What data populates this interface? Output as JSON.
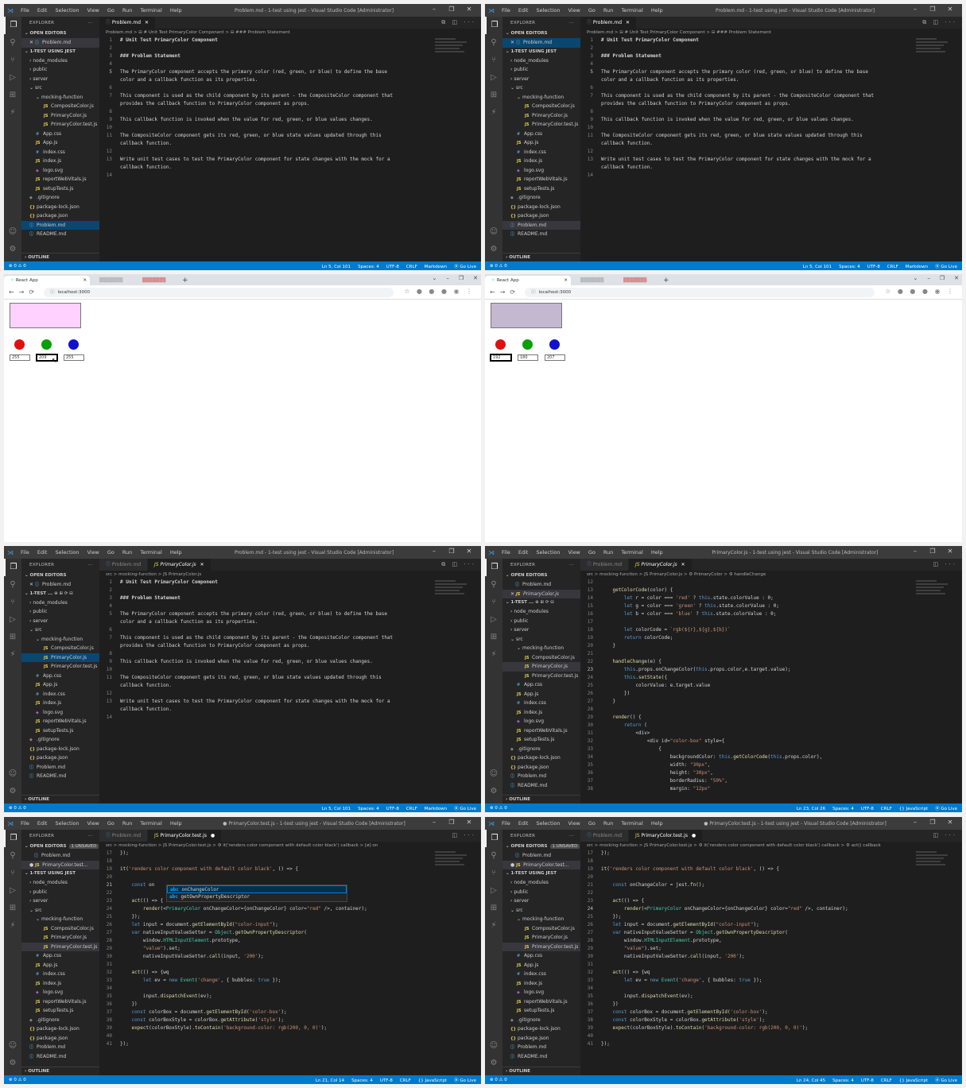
{
  "vscode": {
    "menu": [
      "File",
      "Edit",
      "Selection",
      "View",
      "Go",
      "Run",
      "Terminal",
      "Help"
    ],
    "title_problem": "Problem.md - 1-test using jest - Visual Studio Code [Administrator]",
    "title_primary": "PrimaryColor.js - 1-test using jest - Visual Studio Code [Administrator]",
    "title_test": "● PrimaryColor.test.js - 1-test using jest - Visual Studio Code [Administrator]",
    "explorer": "EXPLORER",
    "open_editors": "OPEN EDITORS",
    "unsaved": "1 UNSAVED",
    "project": "1-TEST USING JEST",
    "project_short": "1-TEST ...",
    "outline": "OUTLINE",
    "files": {
      "node_modules": "node_modules",
      "public": "public",
      "server": "server",
      "src": "src",
      "mocking_function": "mocking-function",
      "composite": "CompositeColor.js",
      "primary": "PrimaryColor.js",
      "primary_test": "PrimaryColor.test.js",
      "primary_test_trunc": "PrimaryColor.test...",
      "app_css": "App.css",
      "app_js": "App.js",
      "index_css": "index.css",
      "index_js": "index.js",
      "logo": "logo.svg",
      "report": "reportWebVitals.js",
      "setup": "setupTests.js",
      "gitignore": ".gitignore",
      "pkg_lock": "package-lock.json",
      "pkg": "package.json",
      "problem": "Problem.md",
      "readme": "README.md"
    },
    "tabs": {
      "problem": "Problem.md",
      "primary": "PrimaryColor.js",
      "test": "PrimaryColor.test.js"
    },
    "crumbs": {
      "problem": "Problem.md > ⊟ # Unit Test PrimaryColor Component > ⊟ ### Problem Statement",
      "primary_short": "src > mocking-function > JS PrimaryColor.js",
      "primary_full": "src > mocking-function > JS PrimaryColor.js > ⚙ PrimaryColor > ⚙ handleChange",
      "test_a": "src > mocking-function > JS PrimaryColor.test.js > ⚙ it('renders color component with default color black') callback > [ø] on",
      "test_b": "src > mocking-function > JS PrimaryColor.test.js > ⚙ it('renders color component with default color black') callback > ⚙ act() callback"
    },
    "markdown": [
      {
        "n": "1",
        "t": "# Unit Test PrimaryColor Component",
        "h": true
      },
      {
        "n": "2",
        "t": ""
      },
      {
        "n": "3",
        "t": "### Problem Statement",
        "h": true
      },
      {
        "n": "4",
        "t": ""
      },
      {
        "n": "5",
        "t": "The PrimaryColor component accepts the primary color (red, green, or blue) to define the base"
      },
      {
        "n": "",
        "t": "color and a callback function as its properties."
      },
      {
        "n": "6",
        "t": ""
      },
      {
        "n": "7",
        "t": "This component is used as the child component by its parent - the CompositeColor component that"
      },
      {
        "n": "",
        "t": "provides the callback function to PrimaryColor component as props."
      },
      {
        "n": "8",
        "t": ""
      },
      {
        "n": "9",
        "t": "This callback function is invoked when the value for red, green, or blue values changes."
      },
      {
        "n": "10",
        "t": ""
      },
      {
        "n": "11",
        "t": "The CompositeColor component gets its red, green, or blue state values updated through this"
      },
      {
        "n": "",
        "t": "callback function."
      },
      {
        "n": "12",
        "t": ""
      },
      {
        "n": "13",
        "t": "Write unit test cases to test the PrimaryColor component for state changes with the mock for a"
      },
      {
        "n": "",
        "t": "callback function."
      },
      {
        "n": "14",
        "t": ""
      }
    ],
    "primary_code": [
      {
        "n": "12",
        "t": ""
      },
      {
        "n": "13",
        "t": "    getColorCode(color) {"
      },
      {
        "n": "14",
        "t": "        let r = color === 'red' ? this.state.colorValue : 0;"
      },
      {
        "n": "15",
        "t": "        let g = color === 'green' ? this.state.colorValue : 0;"
      },
      {
        "n": "16",
        "t": "        let b = color === 'blue' ? this.state.colorValue : 0;"
      },
      {
        "n": "17",
        "t": ""
      },
      {
        "n": "18",
        "t": "        let colorCode = `rgb(${r},${g},${b})`"
      },
      {
        "n": "19",
        "t": "        return colorCode;"
      },
      {
        "n": "20",
        "t": "    }"
      },
      {
        "n": "21",
        "t": ""
      },
      {
        "n": "22",
        "t": "    handleChange(e) {"
      },
      {
        "n": "23",
        "t": "        this.props.onChangeColor(this.props.color,e.target.value);"
      },
      {
        "n": "24",
        "t": "        this.setState({"
      },
      {
        "n": "25",
        "t": "            colorValue: e.target.value"
      },
      {
        "n": "26",
        "t": "        })"
      },
      {
        "n": "27",
        "t": "    }"
      },
      {
        "n": "28",
        "t": ""
      },
      {
        "n": "29",
        "t": "    render() {"
      },
      {
        "n": "30",
        "t": "        return ("
      },
      {
        "n": "31",
        "t": "            <div>"
      },
      {
        "n": "32",
        "t": "                <div id=\"color-box\" style={"
      },
      {
        "n": "33",
        "t": "                    {"
      },
      {
        "n": "34",
        "t": "                        backgroundColor: this.getColorCode(this.props.color),"
      },
      {
        "n": "35",
        "t": "                        width: \"30px\","
      },
      {
        "n": "36",
        "t": "                        height: \"30px\","
      },
      {
        "n": "37",
        "t": "                        borderRadius: \"50%\","
      },
      {
        "n": "38",
        "t": "                        margin: \"12px\""
      }
    ],
    "test_code_a": [
      {
        "n": "17",
        "t": "});"
      },
      {
        "n": "18",
        "t": ""
      },
      {
        "n": "19",
        "t": "it('renders color component with default color black', () => {"
      },
      {
        "n": "20",
        "t": ""
      },
      {
        "n": "21",
        "t": "    const on"
      },
      {
        "n": "22",
        "t": ""
      },
      {
        "n": "23",
        "t": "    act(() => {"
      },
      {
        "n": "24",
        "t": "        render(<PrimaryColor onChangeColor={onChangeColor} color=\"red\" />, container);"
      },
      {
        "n": "25",
        "t": "    });"
      },
      {
        "n": "26",
        "t": "    let input = document.getElementById(\"color-input\");"
      },
      {
        "n": "27",
        "t": "    var nativeInputValueSetter = Object.getOwnPropertyDescriptor("
      },
      {
        "n": "28",
        "t": "        window.HTMLInputElement.prototype,"
      },
      {
        "n": "29",
        "t": "        \"value\").set;"
      },
      {
        "n": "30",
        "t": "        nativeInputValueSetter.call(input, '200');"
      },
      {
        "n": "31",
        "t": ""
      },
      {
        "n": "32",
        "t": "    act(() => {wq"
      },
      {
        "n": "33",
        "t": "        let ev = new Event('change', { bubbles: true });"
      },
      {
        "n": "34",
        "t": ""
      },
      {
        "n": "35",
        "t": "        input.dispatchEvent(ev);"
      },
      {
        "n": "36",
        "t": "    })"
      },
      {
        "n": "37",
        "t": "    const colorBox = document.getElementById('color-box');"
      },
      {
        "n": "38",
        "t": "    const colorBoxStyle = colorBox.getAttribute('style');"
      },
      {
        "n": "39",
        "t": "    expect(colorBoxStyle).toContain('background-color: rgb(200, 0, 0)');"
      },
      {
        "n": "40",
        "t": ""
      },
      {
        "n": "41",
        "t": "});"
      }
    ],
    "test_code_b": [
      {
        "n": "17",
        "t": "});"
      },
      {
        "n": "18",
        "t": ""
      },
      {
        "n": "19",
        "t": "it('renders color component with default color black', () => {"
      },
      {
        "n": "20",
        "t": ""
      },
      {
        "n": "21",
        "t": "    const onChangeColor = jest.fn();"
      },
      {
        "n": "22",
        "t": ""
      },
      {
        "n": "23",
        "t": "    act(() => {"
      },
      {
        "n": "24",
        "t": "        render(<PrimaryColor onChangeColor={onChangeColor} color=\"red\" />, container);"
      },
      {
        "n": "25",
        "t": "    });"
      },
      {
        "n": "26",
        "t": "    let input = document.getElementById(\"color-input\");"
      },
      {
        "n": "27",
        "t": "    var nativeInputValueSetter = Object.getOwnPropertyDescriptor("
      },
      {
        "n": "28",
        "t": "        window.HTMLInputElement.prototype,"
      },
      {
        "n": "29",
        "t": "        \"value\").set;"
      },
      {
        "n": "30",
        "t": "        nativeInputValueSetter.call(input, '200');"
      },
      {
        "n": "31",
        "t": ""
      },
      {
        "n": "32",
        "t": "    act(() => {wq"
      },
      {
        "n": "33",
        "t": "        let ev = new Event('change', { bubbles: true });"
      },
      {
        "n": "34",
        "t": ""
      },
      {
        "n": "35",
        "t": "        input.dispatchEvent(ev);"
      },
      {
        "n": "36",
        "t": "    })"
      },
      {
        "n": "37",
        "t": "    const colorBox = document.getElementById('color-box');"
      },
      {
        "n": "38",
        "t": "    const colorBoxStyle = colorBox.getAttribute('style');"
      },
      {
        "n": "39",
        "t": "    expect(colorBoxStyle).toContain('background-color: rgb(200, 0, 0)');"
      },
      {
        "n": "40",
        "t": ""
      },
      {
        "n": "41",
        "t": "});"
      }
    ],
    "autocomplete": [
      "onChangeColor",
      "getOwnPropertyDescriptor"
    ],
    "status": {
      "left": "⊗ 0 ⚠ 0",
      "md": [
        "Ln 5, Col 101",
        "Spaces: 4",
        "UTF-8",
        "CRLF",
        "Markdown",
        "⦿ Go Live"
      ],
      "js": [
        "Ln 23, Col 26",
        "Spaces: 4",
        "UTF-8",
        "CRLF",
        "{} JavaScript",
        "⦿ Go Live"
      ],
      "test_a": [
        "Ln 21, Col 14",
        "Spaces: 4",
        "UTF-8",
        "CRLF",
        "{} JavaScript",
        "⦿ Go Live"
      ],
      "test_b": [
        "Ln 24, Col 45",
        "Spaces: 4",
        "UTF-8",
        "CRLF",
        "{} JavaScript",
        "⦿ Go Live"
      ]
    }
  },
  "browser": {
    "tab_title": "React App",
    "url": "localhost:3000",
    "a": {
      "box_color": "#ffd1ff",
      "values": [
        "255",
        "209",
        "255"
      ]
    },
    "b": {
      "box_color": "#c4b7d0",
      "values": [
        "192",
        "180",
        "207"
      ]
    },
    "circle_colors": [
      "#dd1111",
      "#0a9e0a",
      "#1111cc"
    ]
  }
}
